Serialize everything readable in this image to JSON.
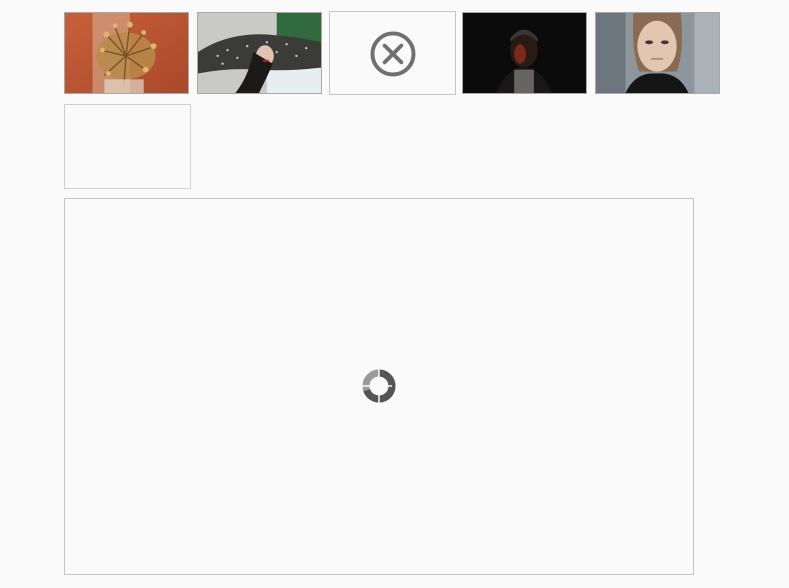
{
  "gallery": {
    "thumbnails": [
      {
        "icon": "image-thumbnail",
        "state": "loaded"
      },
      {
        "icon": "image-thumbnail",
        "state": "loaded"
      },
      {
        "icon": "error-circle-x-icon",
        "state": "error"
      },
      {
        "icon": "image-thumbnail",
        "state": "loaded"
      },
      {
        "icon": "image-thumbnail",
        "state": "loaded"
      },
      {
        "icon": "image-thumbnail",
        "state": "empty"
      }
    ],
    "viewer": {
      "state": "loading",
      "icon": "loading-spinner-icon"
    }
  },
  "colors": {
    "background": "#fafafa",
    "thumb_border": "#a8a8a8",
    "viewer_border": "#c4c4c4",
    "error_icon": "#707070",
    "spinner_dark": "#555555",
    "spinner_light": "#9a9a9a"
  }
}
